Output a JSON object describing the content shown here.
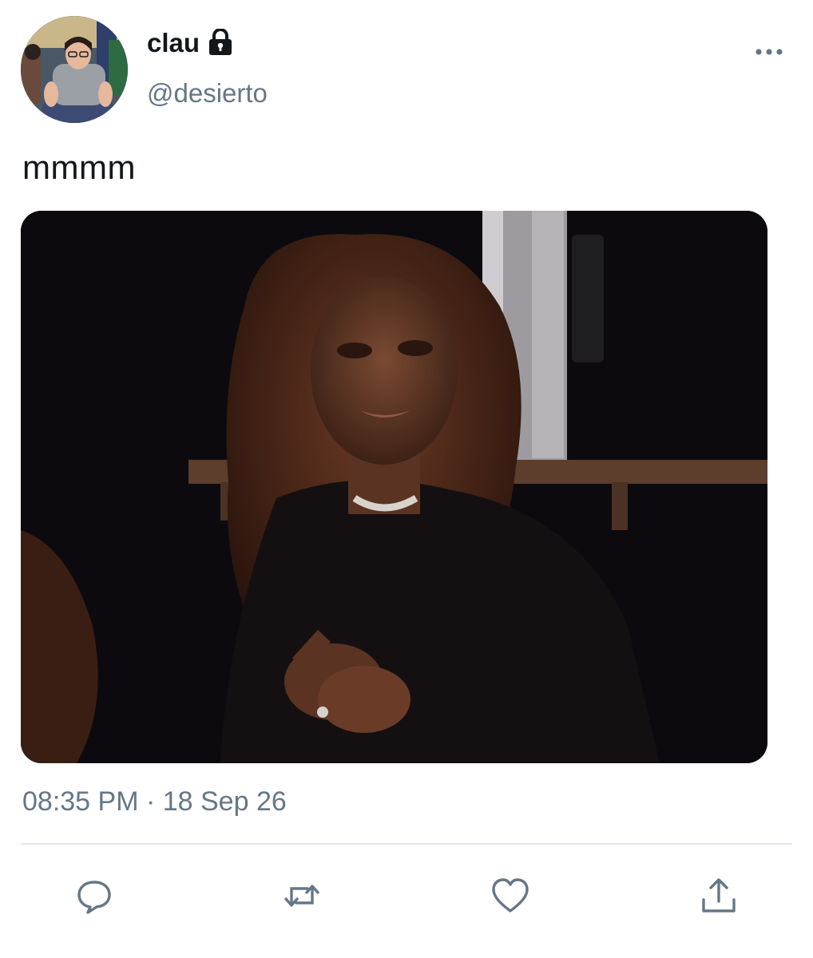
{
  "author": {
    "display_name": "clau",
    "handle": "@desierto",
    "protected": true
  },
  "tweet": {
    "text": "mmmm",
    "timestamp": "08:35 PM · 18 Sep 26"
  },
  "icons": {
    "lock": "lock-icon",
    "more": "more-horizontal-icon",
    "reply": "reply-icon",
    "retweet": "retweet-icon",
    "like": "heart-icon",
    "share": "share-icon"
  },
  "colors": {
    "text_primary": "#14171a",
    "text_secondary": "#657786",
    "divider": "#e1e8ed",
    "icon": "#657786"
  }
}
